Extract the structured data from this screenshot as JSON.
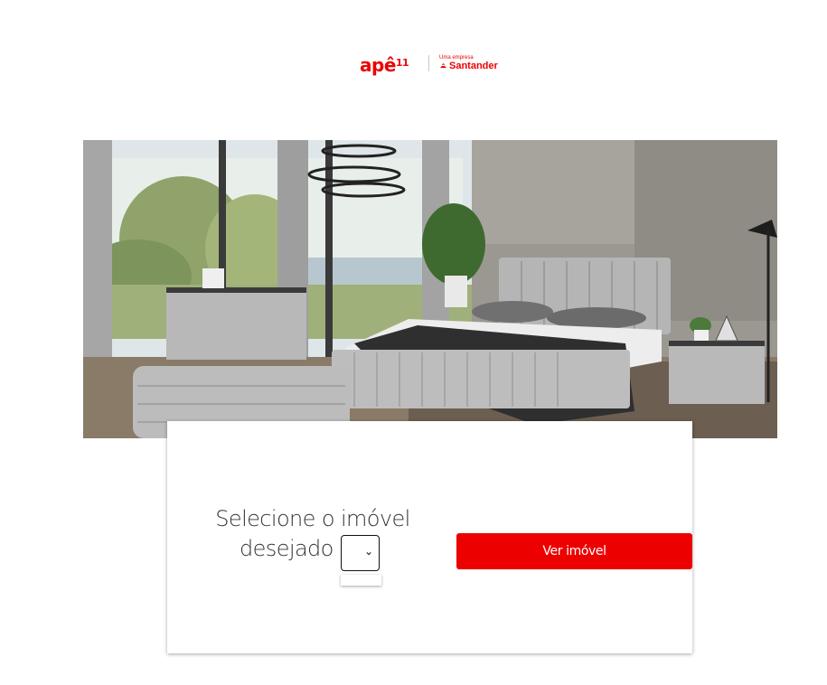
{
  "brand": {
    "ape_logo": "apê",
    "ape_number": "11",
    "tagline": "Uma empresa",
    "parent": "Santander"
  },
  "hero": {
    "image_icon": "bedroom-photo"
  },
  "form": {
    "label_line1": "Selecione o imóvel",
    "label_line2": "desejado",
    "select_value": "",
    "submit_label": "Ver imóvel"
  },
  "colors": {
    "brand_red": "#ec0000"
  }
}
